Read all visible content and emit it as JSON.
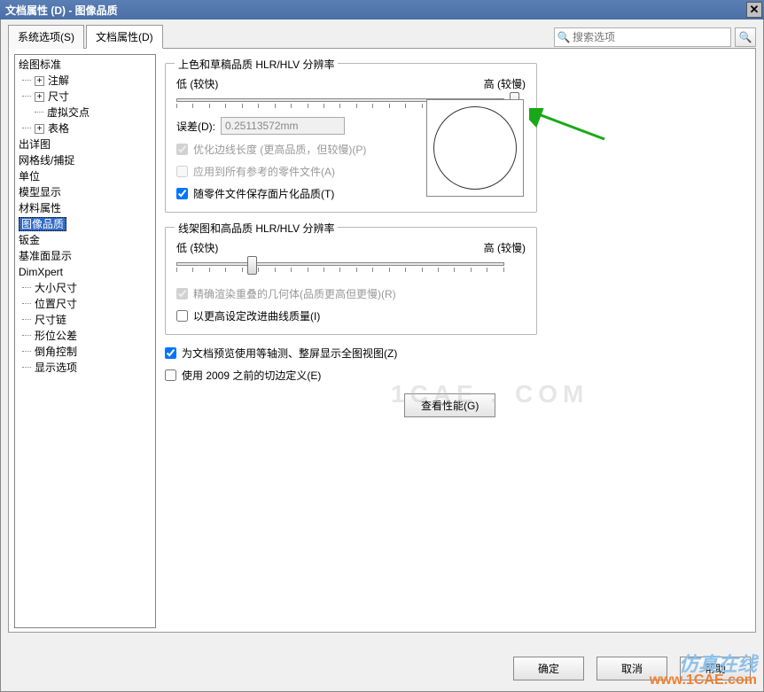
{
  "title": "文档属性 (D)  -  图像品质",
  "tabs": {
    "system": "系统选项(S)",
    "doc": "文档属性(D)"
  },
  "search_placeholder": "搜索选项",
  "tree": {
    "drawing_std": "绘图标准",
    "annot": "注解",
    "dim": "尺寸",
    "virtual": "虚拟交点",
    "table": "表格",
    "detailing": "出详图",
    "grid": "网格线/捕捉",
    "units": "单位",
    "model_disp": "模型显示",
    "material": "材料属性",
    "image_quality": "图像品质",
    "sheetmetal": "钣金",
    "plane_disp": "基准面显示",
    "dimxpert": "DimXpert",
    "size_dim": "大小尺寸",
    "pos_dim": "位置尺寸",
    "dim_chain": "尺寸链",
    "geom_tol": "形位公差",
    "chamfer": "倒角控制",
    "disp_opt": "显示选项"
  },
  "group1": {
    "title": "上色和草稿品质 HLR/HLV 分辨率",
    "low": "低 (较快)",
    "high": "高 (较慢)",
    "deviation_label": "误差(D):",
    "deviation_value": "0.25113572mm",
    "chk_optimize": "优化边线长度 (更高品质，但较慢)(P)",
    "chk_apply": "应用到所有参考的零件文件(A)",
    "chk_save": "随零件文件保存面片化品质(T)"
  },
  "group2": {
    "title": "线架图和高品质 HLR/HLV 分辨率",
    "low": "低 (较快)",
    "high": "高 (较慢)",
    "chk_precise": "精确渲染重叠的几何体(品质更高但更慢)(R)",
    "chk_higher": "以更高设定改进曲线质量(I)"
  },
  "chk_iso": "为文档预览使用等轴测、整屏显示全图视图(Z)",
  "chk_2009": "使用 2009 之前的切边定义(E)",
  "btn_perf": "查看性能(G)",
  "btn_ok": "确定",
  "btn_cancel": "取消",
  "btn_help": "帮助",
  "watermark1": "仿真在线",
  "watermark2": "www.1CAE.com",
  "watermark_bg": "1CAE . COM"
}
